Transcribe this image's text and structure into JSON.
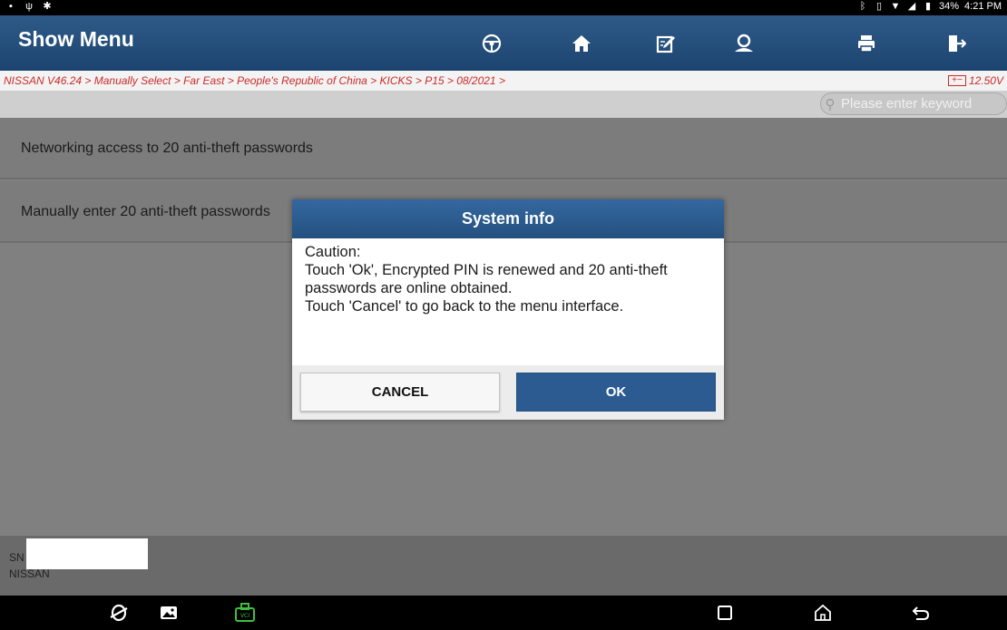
{
  "status_bar": {
    "left_icons": [
      "image-icon",
      "usb-icon",
      "settings-icon"
    ],
    "right_icons": [
      "bluetooth-icon",
      "vibrate-icon",
      "wifi-icon",
      "signal-icon",
      "battery-icon"
    ],
    "battery_percent": "34%",
    "time": "4:21 PM"
  },
  "header": {
    "title": "Show Menu",
    "toolbar": [
      "steering-wheel-icon",
      "home-icon",
      "edit-icon",
      "user-icon",
      "print-icon",
      "exit-icon"
    ]
  },
  "breadcrumb": {
    "path": "NISSAN V46.24 > Manually Select > Far East > People's Republic of China > KICKS > P15 > 08/2021 >",
    "voltage": "12.50V"
  },
  "search": {
    "placeholder": "Please enter keyword"
  },
  "menu": {
    "items": [
      {
        "label": "Networking access to 20 anti-theft passwords"
      },
      {
        "label": "Manually enter 20 anti-theft passwords"
      }
    ]
  },
  "dialog": {
    "title": "System info",
    "message": "Caution:\nTouch 'Ok', Encrypted PIN is renewed and 20 anti-theft passwords are online obtained.\nTouch 'Cancel' to go back to the menu interface.",
    "cancel_label": "CANCEL",
    "ok_label": "OK"
  },
  "footer": {
    "sn_label": "SN",
    "make": "NISSAN"
  },
  "nav_bar": [
    "browser-icon",
    "gallery-icon",
    "vci-icon",
    "recent-apps-icon",
    "home-icon",
    "back-icon"
  ],
  "colors": {
    "header_bg": "#1d4470",
    "breadcrumb_text": "#cc2a2a",
    "ok_button": "#2b5b91"
  }
}
